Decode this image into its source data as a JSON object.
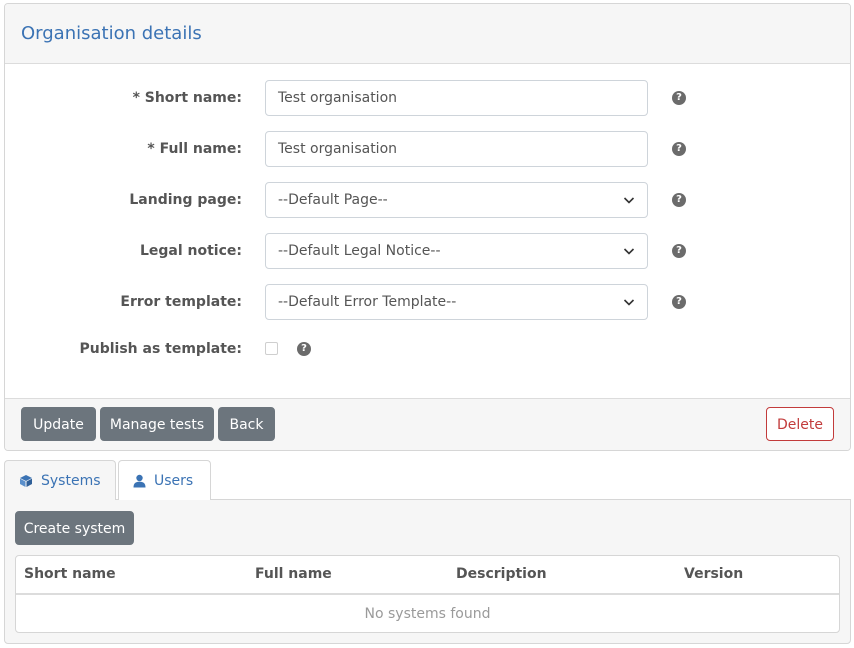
{
  "panel": {
    "title": "Organisation details",
    "fields": {
      "short_name": {
        "label": "* Short name:",
        "value": "Test organisation"
      },
      "full_name": {
        "label": "* Full name:",
        "value": "Test organisation"
      },
      "landing_page": {
        "label": "Landing page:",
        "value": "--Default Page--"
      },
      "legal_notice": {
        "label": "Legal notice:",
        "value": "--Default Legal Notice--"
      },
      "error_template": {
        "label": "Error template:",
        "value": "--Default Error Template--"
      },
      "publish_template": {
        "label": "Publish as template:",
        "checked": false
      }
    },
    "help_glyph": "?",
    "footer": {
      "update_label": "Update",
      "manage_tests_label": "Manage tests",
      "back_label": "Back",
      "delete_label": "Delete"
    }
  },
  "tabs": [
    {
      "label": "Systems",
      "icon": "cube-icon",
      "active": true
    },
    {
      "label": "Users",
      "icon": "user-icon",
      "active": false
    }
  ],
  "systems": {
    "create_label": "Create system",
    "columns": [
      "Short name",
      "Full name",
      "Description",
      "Version"
    ],
    "empty_message": "No systems found"
  },
  "colors": {
    "accent": "#3b73b4",
    "button_dark": "#6c757d",
    "danger": "#c23b3b"
  }
}
